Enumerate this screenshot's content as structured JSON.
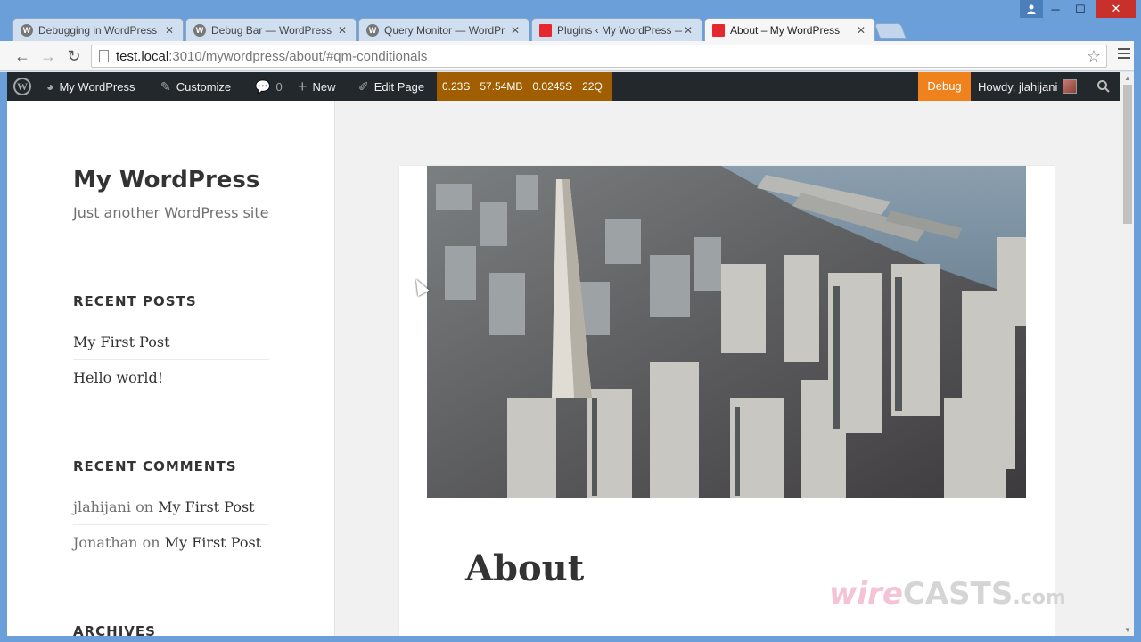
{
  "window": {
    "user_icon": "user-icon",
    "minimize": "─",
    "maximize": "☐",
    "close": "✕"
  },
  "tabs": [
    {
      "label": "Debugging in WordPress",
      "favicon": "wordpress-icon",
      "active": false
    },
    {
      "label": "Debug Bar — WordPress",
      "favicon": "wordpress-icon",
      "active": false
    },
    {
      "label": "Query Monitor — WordPr",
      "favicon": "wordpress-icon",
      "active": false
    },
    {
      "label": "Plugins ‹ My WordPress —",
      "favicon": "red-square-icon",
      "active": false
    },
    {
      "label": "About – My WordPress",
      "favicon": "red-square-icon",
      "active": true
    }
  ],
  "toolbar": {
    "back": "←",
    "forward": "→",
    "reload": "↻",
    "url_host": "test.local",
    "url_rest": ":3010/mywordpress/about/#qm-conditionals",
    "star": "☆"
  },
  "adminbar": {
    "site_name": "My WordPress",
    "customize": "Customize",
    "comments_count": "0",
    "new": "New",
    "edit_page": "Edit Page",
    "qm": {
      "time": "0.23S",
      "memory": "57.54MB",
      "db_time": "0.0245S",
      "queries": "22Q"
    },
    "debug": "Debug",
    "howdy": "Howdy, jlahijani",
    "accent": "#a05e00",
    "debug_color": "#f0821e"
  },
  "sidebar": {
    "site_title": "My WordPress",
    "site_description": "Just another WordPress site",
    "recent_posts_title": "RECENT POSTS",
    "recent_posts": [
      "My First Post",
      "Hello world!"
    ],
    "recent_comments_title": "RECENT COMMENTS",
    "recent_comments": [
      {
        "author": "jlahijani",
        "on": "on",
        "post": "My First Post"
      },
      {
        "author": "Jonathan",
        "on": "on",
        "post": "My First Post"
      }
    ],
    "archives_title": "ARCHIVES"
  },
  "content": {
    "page_title": "About",
    "featured_image": "aerial city skyline photo"
  },
  "watermark": {
    "wire": "wire",
    "casts": "CASTS",
    "dot_com": ".com"
  }
}
